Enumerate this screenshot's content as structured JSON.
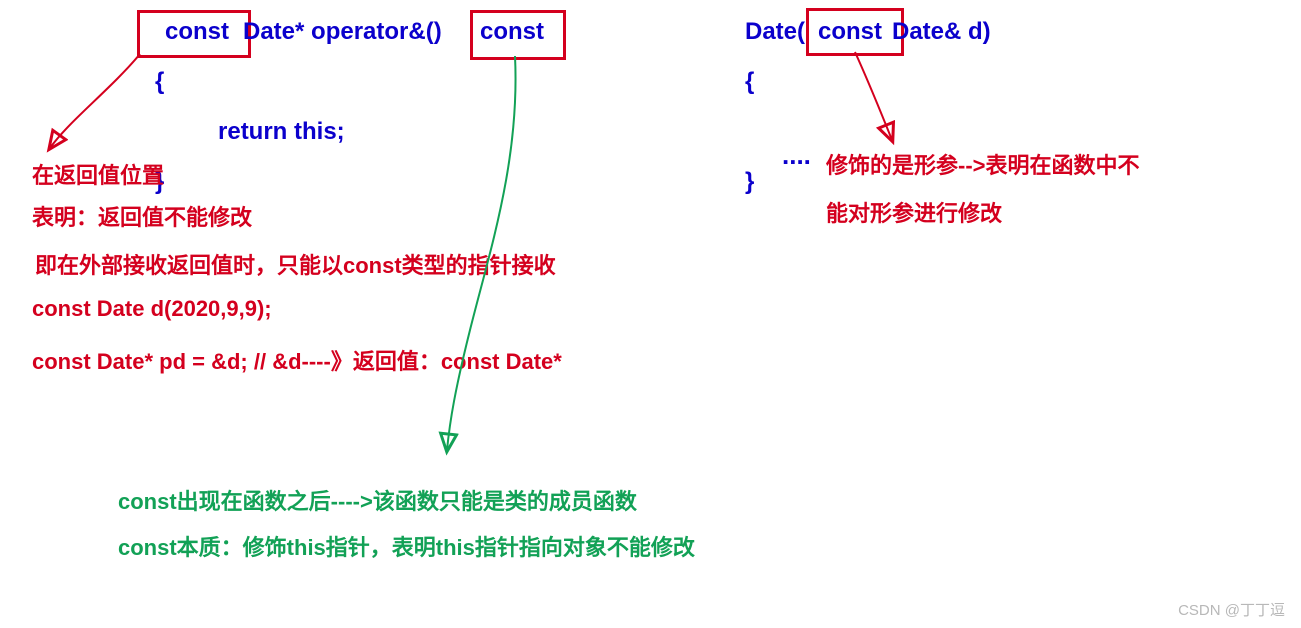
{
  "code_left": {
    "l1a": "const",
    "l1b": " Date* operator&()",
    "l1c": "const",
    "l2": "{",
    "l3": "return this;",
    "l4": "}"
  },
  "code_right": {
    "l1a": "Date(",
    "l1b": "const",
    "l1c": " Date& d)",
    "l2": "{",
    "dots": "....",
    "l4": "}"
  },
  "red": {
    "r1": "在返回值位置",
    "r2": "表明：返回值不能修改",
    "r3": "即在外部接收返回值时，只能以const类型的指针接收",
    "r4": "const  Date d(2020,9,9);",
    "r5": "const Date* pd =  &d;    // &d----》返回值：const Date*",
    "p1": "修饰的是形参-->表明在函数中不",
    "p2": "能对形参进行修改"
  },
  "green": {
    "g1": "const出现在函数之后---->该函数只能是类的成员函数",
    "g2": "const本质：修饰this指针，表明this指针指向对象不能修改"
  },
  "watermark": "CSDN @丁丁逗"
}
